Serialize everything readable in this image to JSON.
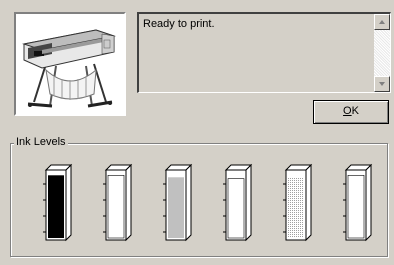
{
  "status": {
    "message": "Ready to print."
  },
  "buttons": {
    "ok_mnemonic": "O",
    "ok_rest": "K"
  },
  "ink": {
    "group_label": "Ink Levels",
    "cartridges": [
      {
        "fill_fraction": 0.95,
        "fill_color": "#000000",
        "pattern": "solid"
      },
      {
        "fill_fraction": 0.95,
        "fill_color": "#ffffff",
        "pattern": "solid"
      },
      {
        "fill_fraction": 0.92,
        "fill_color": "#c0c0c0",
        "pattern": "solid"
      },
      {
        "fill_fraction": 0.9,
        "fill_color": "#ffffff",
        "pattern": "solid"
      },
      {
        "fill_fraction": 0.92,
        "fill_color": "#d8d8d8",
        "pattern": "dither"
      },
      {
        "fill_fraction": 0.95,
        "fill_color": "#ffffff",
        "pattern": "solid"
      }
    ]
  },
  "icons": {
    "printer": "plotter-printer-icon",
    "scroll_up": "scroll-up-arrow-icon",
    "scroll_down": "scroll-down-arrow-icon"
  }
}
